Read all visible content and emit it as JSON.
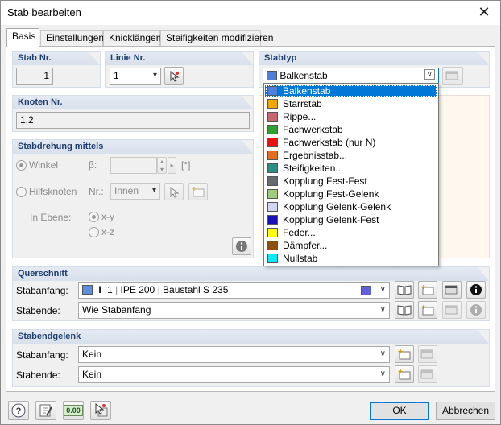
{
  "window": {
    "title": "Stab bearbeiten",
    "close_symbol": "✕"
  },
  "tabs": [
    "Basis",
    "Einstellungen",
    "Knicklängen",
    "Steifigkeiten modifizieren"
  ],
  "stab_nr": {
    "heading": "Stab Nr.",
    "value": "1"
  },
  "linie_nr": {
    "heading": "Linie Nr.",
    "value": "1"
  },
  "stabtyp": {
    "heading": "Stabtyp",
    "selected": "Balkenstab",
    "selected_color": "#4f7fd8",
    "options": [
      {
        "label": "Balkenstab",
        "color": "#4f7fd8"
      },
      {
        "label": "Starrstab",
        "color": "#f0a800"
      },
      {
        "label": "Rippe...",
        "color": "#c86470"
      },
      {
        "label": "Fachwerkstab",
        "color": "#2fa02f"
      },
      {
        "label": "Fachwerkstab (nur N)",
        "color": "#e81010"
      },
      {
        "label": "Ergebnisstab...",
        "color": "#e07020"
      },
      {
        "label": "Steifigkeiten...",
        "color": "#2e8c86"
      },
      {
        "label": "Kopplung Fest-Fest",
        "color": "#666a70"
      },
      {
        "label": "Kopplung Fest-Gelenk",
        "color": "#9ccc7c"
      },
      {
        "label": "Kopplung Gelenk-Gelenk",
        "color": "#d2d4f2"
      },
      {
        "label": "Kopplung Gelenk-Fest",
        "color": "#1810b8"
      },
      {
        "label": "Feder...",
        "color": "#ffff00"
      },
      {
        "label": "Dämpfer...",
        "color": "#8c5010"
      },
      {
        "label": "Nullstab",
        "color": "#10e8f8"
      }
    ]
  },
  "knoten_nr": {
    "heading": "Knoten Nr.",
    "value": "1,2"
  },
  "stabdrehung": {
    "heading": "Stabdrehung mittels",
    "winkel_label": "Winkel",
    "beta_label": "β:",
    "unit": "[°]",
    "hilfsknoten_label": "Hilfsknoten",
    "nr_label": "Nr.:",
    "innen_value": "Innen",
    "in_ebene_label": "In Ebene:",
    "xy_label": "x-y",
    "xz_label": "x-z"
  },
  "querschnitt": {
    "heading": "Querschnitt",
    "start_label": "Stabanfang:",
    "start_no": "1",
    "start_profile": "IPE 200",
    "start_material": "Baustahl S 235",
    "start_color": "#5a8ee0",
    "material_color": "#6060d8",
    "end_label": "Stabende:",
    "end_value": "Wie Stabanfang"
  },
  "stabendgelenk": {
    "heading": "Stabendgelenk",
    "start_label": "Stabanfang:",
    "start_value": "Kein",
    "end_label": "Stabende:",
    "end_value": "Kein"
  },
  "buttons": {
    "ok": "OK",
    "cancel": "Abbrechen"
  },
  "bottom_icons": {
    "zero_label": "0.00"
  }
}
